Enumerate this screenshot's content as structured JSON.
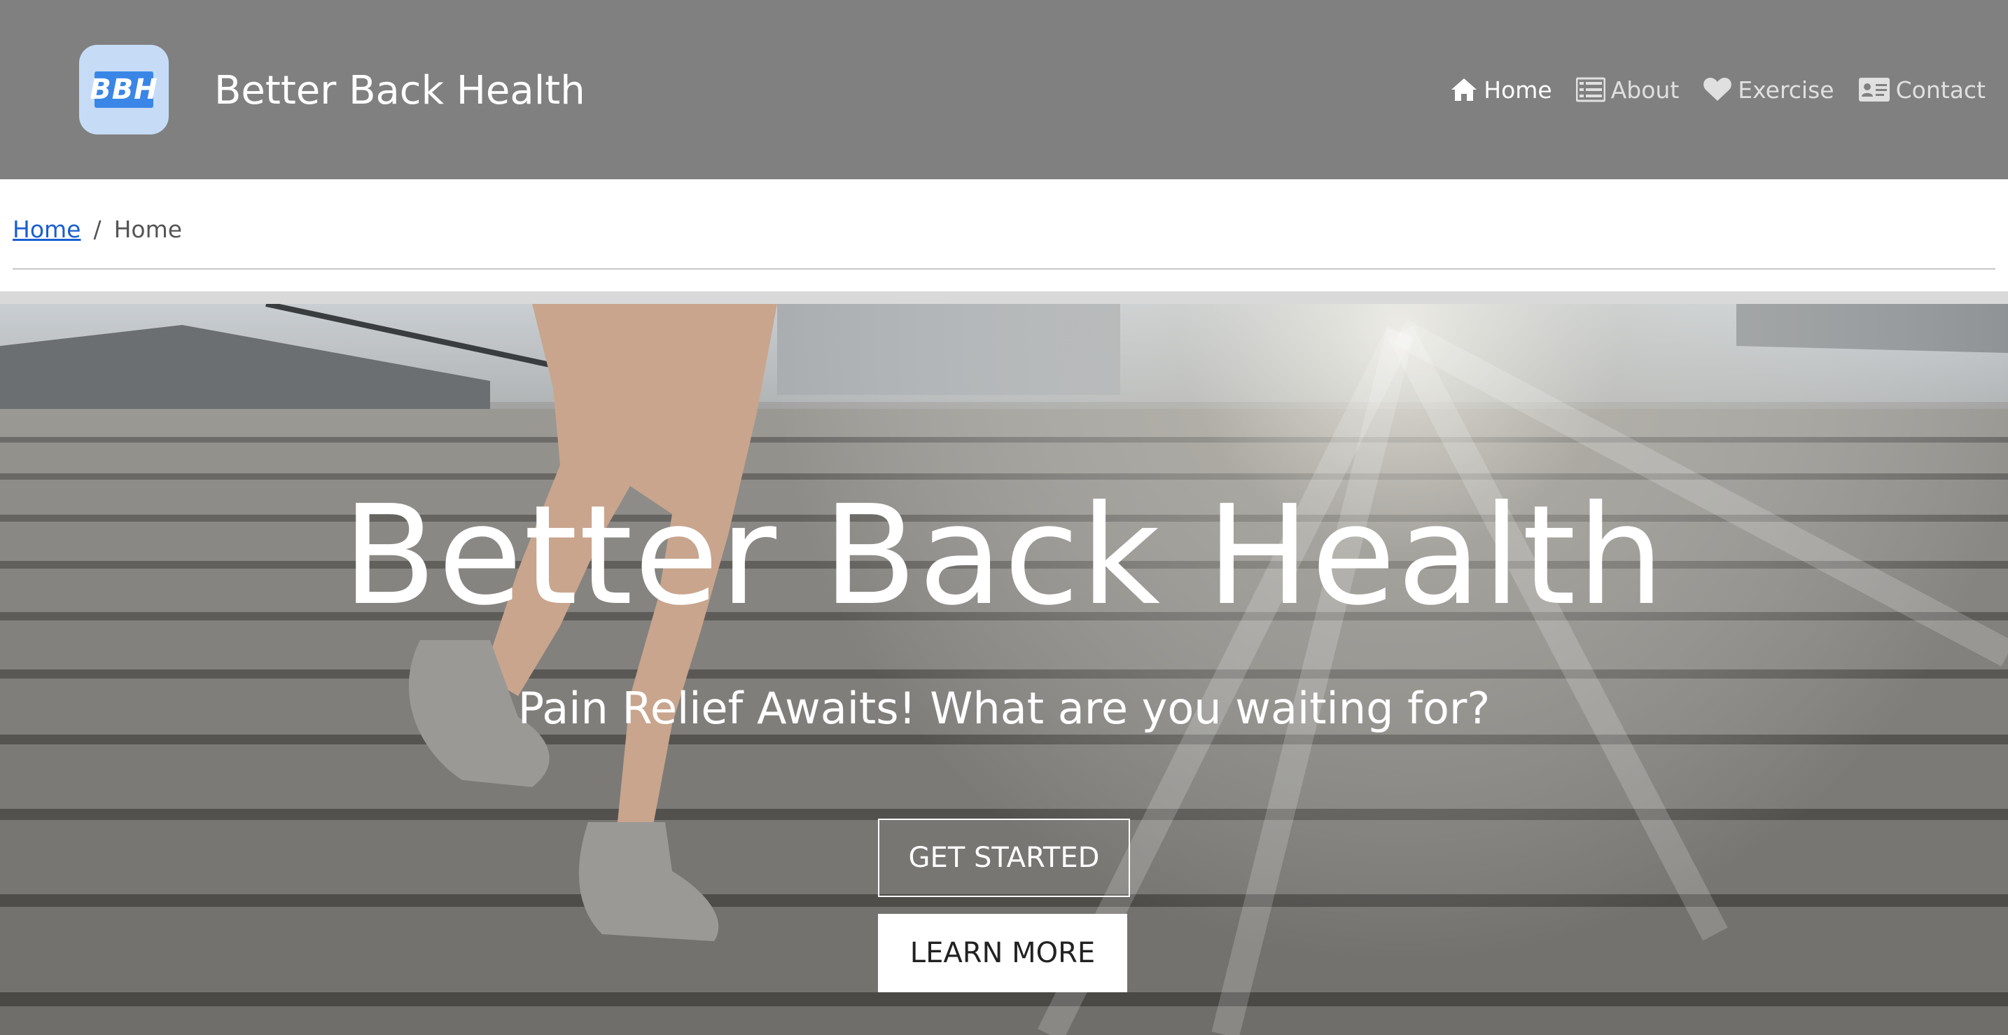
{
  "header": {
    "logo_text": "BBH",
    "brand": "Better Back Health",
    "nav": [
      {
        "label": "Home",
        "icon": "home-icon",
        "active": true
      },
      {
        "label": "About",
        "icon": "list-icon",
        "active": false
      },
      {
        "label": "Exercise",
        "icon": "heart-icon",
        "active": false
      },
      {
        "label": "Contact",
        "icon": "contact-card-icon",
        "active": false
      }
    ]
  },
  "breadcrumb": {
    "link": "Home",
    "separator": "/",
    "current": "Home"
  },
  "hero": {
    "title": "Better Back Health",
    "subtitle": "Pain Relief Awaits! What are you waiting for?",
    "primary_button": "GET STARTED",
    "secondary_button": "LEARN MORE"
  },
  "colors": {
    "header_bg": "#808080",
    "logo_bg": "#c6dcf6",
    "logo_mark": "#3a86e6",
    "link": "#1a5fd0"
  }
}
